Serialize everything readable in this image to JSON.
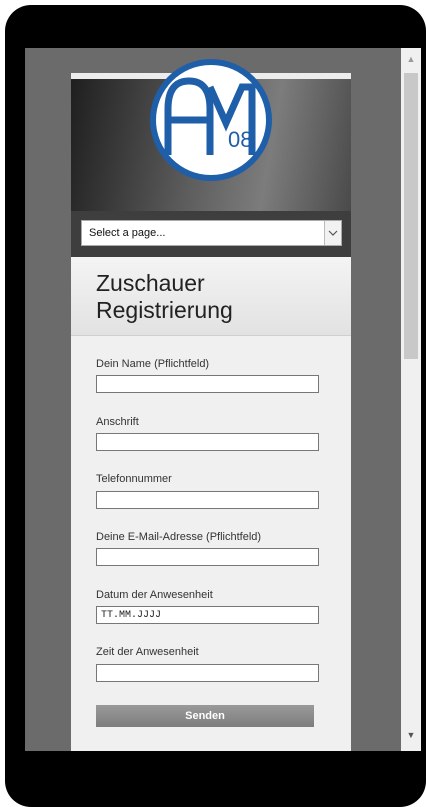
{
  "logo": {
    "text": "AM",
    "suffix": "08",
    "color": "#1f5ea8"
  },
  "nav": {
    "select_placeholder": "Select a page..."
  },
  "page": {
    "title_line1": "Zuschauer",
    "title_line2": "Registrierung"
  },
  "form": {
    "fields": [
      {
        "label": "Dein Name (Pflichtfeld)",
        "value": ""
      },
      {
        "label": "Anschrift",
        "value": ""
      },
      {
        "label": "Telefonnummer",
        "value": ""
      },
      {
        "label": "Deine E-Mail-Adresse (Pflichtfeld)",
        "value": ""
      },
      {
        "label": "Datum der Anwesenheit",
        "value": "TT.MM.JJJJ"
      },
      {
        "label": "Zeit der Anwesenheit",
        "value": ""
      }
    ],
    "submit_label": "Senden"
  },
  "scrollbar": {
    "up_icon": "▲",
    "down_icon": "▼"
  }
}
